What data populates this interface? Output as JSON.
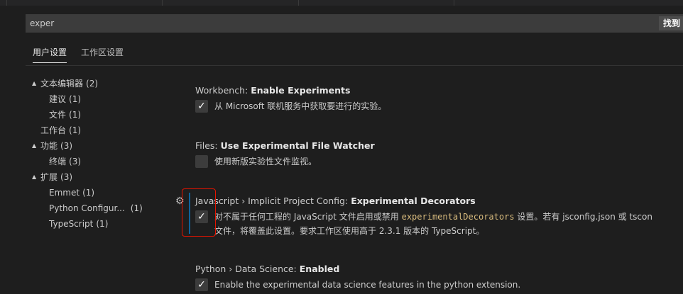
{
  "search": {
    "value": "exper",
    "count_label": "找到"
  },
  "tabs": [
    {
      "label": "用户设置"
    },
    {
      "label": "工作区设置"
    }
  ],
  "toc": {
    "items": [
      {
        "label": "文本编辑器",
        "count": "(2)"
      },
      {
        "label": "建议",
        "count": "(1)"
      },
      {
        "label": "文件",
        "count": "(1)"
      },
      {
        "label": "工作台",
        "count": "(1)"
      },
      {
        "label": "功能",
        "count": "(3)"
      },
      {
        "label": "终端",
        "count": "(3)"
      },
      {
        "label": "扩展",
        "count": "(3)"
      },
      {
        "label": "Emmet",
        "count": "(1)"
      },
      {
        "label": "Python Configur...",
        "count": "(1)"
      },
      {
        "label": "TypeScript",
        "count": "(1)"
      }
    ],
    "twistie_glyph": "▲"
  },
  "settings": [
    {
      "category": "Workbench: ",
      "name": "Enable Experiments",
      "checked": true,
      "description": "从 Microsoft 联机服务中获取要进行的实验。"
    },
    {
      "category": "Files: ",
      "name": "Use Experimental File Watcher",
      "checked": false,
      "description": "使用新版实验性文件监视。"
    },
    {
      "category": "Javascript › Implicit Project Config: ",
      "name": "Experimental Decorators",
      "checked": true,
      "description_before": "对不属于任何工程的 JavaScript 文件启用或禁用 ",
      "description_code": "experimentalDecorators",
      "description_after": " 设置。若有 jsconfig.json 或 tscon",
      "description_line2": "文件，将覆盖此设置。要求工作区使用高于 2.3.1 版本的 TypeScript。"
    },
    {
      "category": "Python › Data Science: ",
      "name": "Enabled",
      "checked": true,
      "description": "Enable the experimental data science features in the python extension."
    }
  ],
  "checkmark_glyph": "✓",
  "gear_glyph": "⚙",
  "colors": {
    "background": "#1e1e1e",
    "accent_focus": "#0e639c",
    "annotation_red": "#e51400",
    "code_highlight": "#d7ba7d"
  }
}
